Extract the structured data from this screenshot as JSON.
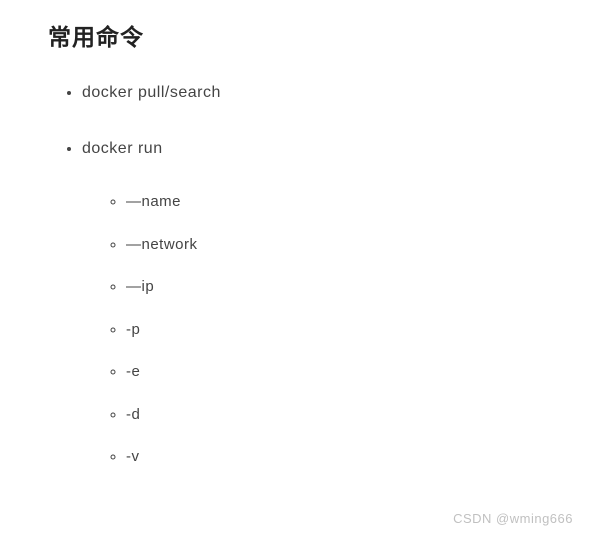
{
  "heading": "常用命令",
  "list": {
    "items": [
      {
        "text": "docker pull/search"
      },
      {
        "text": "docker run",
        "children": [
          {
            "text": "—name"
          },
          {
            "text": "—network"
          },
          {
            "text": "—ip"
          },
          {
            "text": "-p"
          },
          {
            "text": "-e"
          },
          {
            "text": "-d"
          },
          {
            "text": "-v"
          }
        ]
      }
    ]
  },
  "watermark": "CSDN @wming666"
}
